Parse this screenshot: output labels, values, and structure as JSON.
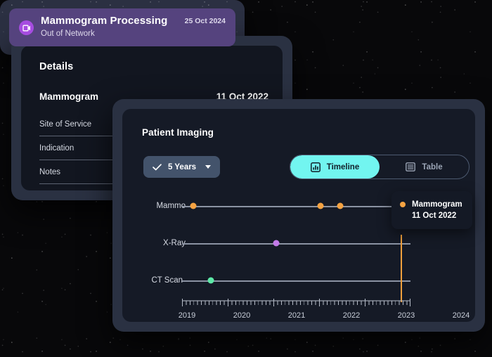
{
  "details": {
    "title": "Details",
    "record_name": "Mammogram",
    "record_date": "11 Oct 2022",
    "rows": [
      {
        "label": "Site of Service"
      },
      {
        "label": "Indication"
      },
      {
        "label": "Notes"
      }
    ]
  },
  "processing_card": {
    "icon": "image-media-icon",
    "title": "Mammogram Processing",
    "subtitle": "Out of Network",
    "date": "25 Oct 2024",
    "background_color": "#55437e",
    "icon_color": "#a64ce0"
  },
  "imaging": {
    "title": "Patient Imaging",
    "range_filter": {
      "icon": "check-icon",
      "label": "5 Years",
      "caret": "chevron-down-icon"
    },
    "view_toggle": {
      "active": "Timeline",
      "options": [
        {
          "label": "Timeline",
          "icon": "bar-chart-icon",
          "active": true
        },
        {
          "label": "Table",
          "icon": "table-list-icon",
          "active": false
        }
      ],
      "active_color": "#72f5f0"
    },
    "tooltip": {
      "title": "Mammogram",
      "date": "11 Oct 2022",
      "dot_color": "#f5a342"
    },
    "marker_color": "#f0a03c"
  },
  "chart_data": {
    "type": "scatter",
    "title": "Patient Imaging",
    "xlabel": "",
    "ylabel": "",
    "xlim": [
      2019.0,
      2024.0
    ],
    "x_tick_labels": [
      "2019",
      "2020",
      "2021",
      "2022",
      "2023",
      "2024"
    ],
    "x_major_ticks": [
      2019,
      2020,
      2021,
      2022,
      2023,
      2024
    ],
    "minor_ticks_per_year": 12,
    "grid": false,
    "legend": "none",
    "marker_line_x": 2022.78,
    "series": [
      {
        "name": "Mammo",
        "color": "#f5a342",
        "points": [
          {
            "x": 2019.2,
            "label": "Mammogram",
            "date": ""
          },
          {
            "x": 2021.42,
            "label": "Mammogram",
            "date": ""
          },
          {
            "x": 2021.75,
            "label": "Mammogram",
            "date": ""
          },
          {
            "x": 2022.78,
            "label": "Mammogram",
            "date": "11 Oct 2022",
            "selected": true
          }
        ]
      },
      {
        "name": "X-Ray",
        "color": "#c27ae8",
        "points": [
          {
            "x": 2020.62,
            "label": "X-Ray",
            "date": ""
          }
        ]
      },
      {
        "name": "CT Scan",
        "color": "#5eeaa8",
        "points": [
          {
            "x": 2019.45,
            "label": "CT Scan",
            "date": ""
          }
        ]
      }
    ]
  }
}
